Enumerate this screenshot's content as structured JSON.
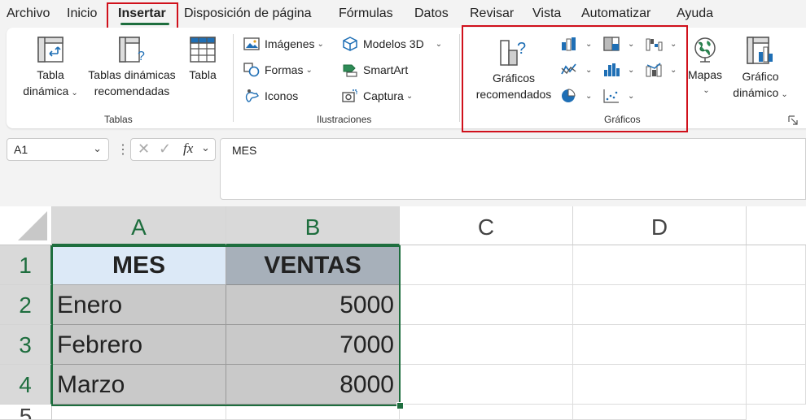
{
  "menu": {
    "tabs": [
      "Archivo",
      "Inicio",
      "Insertar",
      "Disposición de página",
      "Fórmulas",
      "Datos",
      "Revisar",
      "Vista",
      "Automatizar",
      "Ayuda"
    ],
    "active": "Insertar"
  },
  "ribbon": {
    "tablas": {
      "group_label": "Tablas",
      "tabla_dinamica": [
        "Tabla",
        "dinámica"
      ],
      "tablas_recomendadas": [
        "Tablas dinámicas",
        "recomendadas"
      ],
      "tabla": "Tabla"
    },
    "ilustraciones": {
      "group_label": "Ilustraciones",
      "imagenes": "Imágenes",
      "formas": "Formas",
      "iconos": "Iconos",
      "modelos3d": "Modelos 3D",
      "smartart": "SmartArt",
      "captura": "Captura"
    },
    "graficos": {
      "group_label": "Gráficos",
      "recomendados": [
        "Gráficos",
        "recomendados"
      ]
    },
    "mapas": "Mapas",
    "grafico_dinamico": [
      "Gráfico",
      "dinámico"
    ]
  },
  "formula": {
    "name_box": "A1",
    "content": "MES"
  },
  "sheet": {
    "columns": [
      "A",
      "B",
      "C",
      "D"
    ],
    "rows": [
      "1",
      "2",
      "3",
      "4",
      "5"
    ],
    "header": [
      "MES",
      "VENTAS"
    ],
    "data": [
      {
        "mes": "Enero",
        "ventas": "5000"
      },
      {
        "mes": "Febrero",
        "ventas": "7000"
      },
      {
        "mes": "Marzo",
        "ventas": "8000"
      }
    ]
  },
  "colors": {
    "accent": "#1e6e3e",
    "highlight": "#d0101b",
    "header_a_fill": "#dce9f7",
    "header_b_fill": "#a7b0ba",
    "data_fill": "#c9c9c9"
  }
}
